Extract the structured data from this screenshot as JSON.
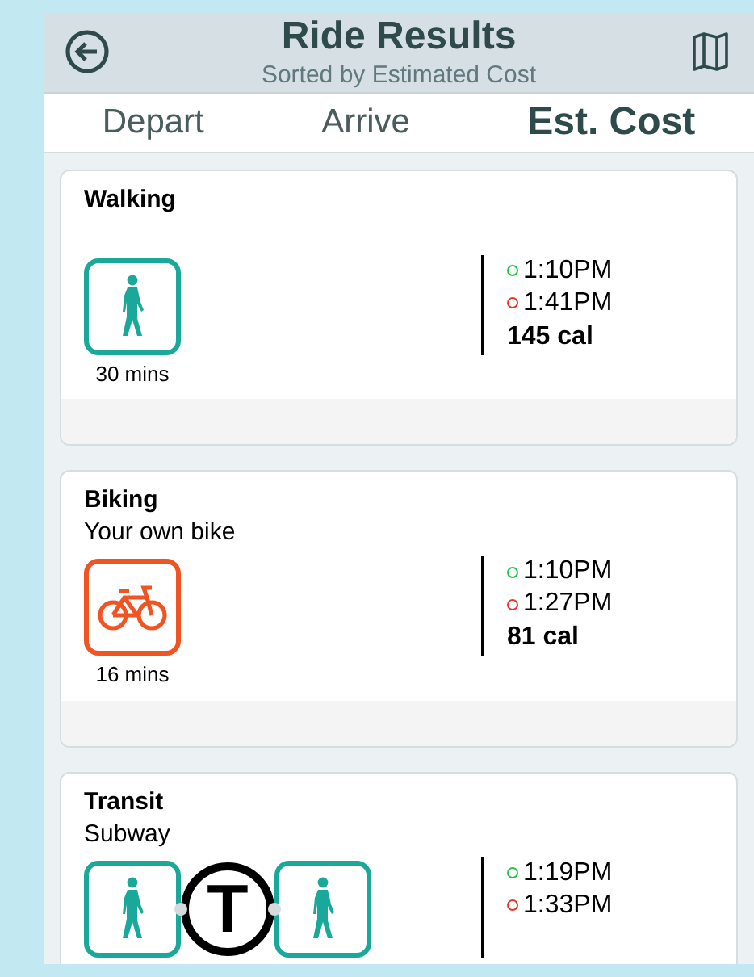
{
  "header": {
    "title": "Ride Results",
    "subtitle": "Sorted by Estimated Cost"
  },
  "tabs": [
    {
      "label": "Depart",
      "selected": false
    },
    {
      "label": "Arrive",
      "selected": false
    },
    {
      "label": "Est. Cost",
      "selected": true
    }
  ],
  "results": [
    {
      "title": "Walking",
      "steps": [
        {
          "kind": "walk"
        }
      ],
      "duration": "30 mins",
      "depart": "1:10PM",
      "arrive": "1:41PM",
      "detail": "145 cal"
    },
    {
      "title": "Biking",
      "subtitle": "Your own bike",
      "steps": [
        {
          "kind": "bike"
        }
      ],
      "duration": "16 mins",
      "depart": "1:10PM",
      "arrive": "1:27PM",
      "detail": "81 cal"
    },
    {
      "title": "Transit",
      "subtitle": "Subway",
      "steps": [
        {
          "kind": "walk"
        },
        {
          "kind": "subway",
          "letter": "T"
        },
        {
          "kind": "walk"
        }
      ],
      "depart": "1:19PM",
      "arrive": "1:33PM"
    }
  ]
}
